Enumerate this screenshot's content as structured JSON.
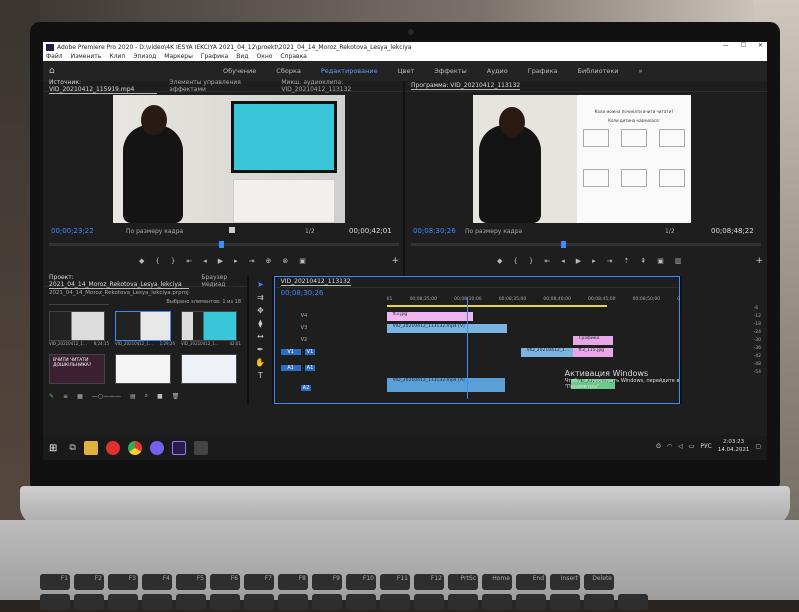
{
  "window": {
    "title": "Adobe Premiere Pro 2020 - D:\\video\\4K IESYA IEKCIYA 2021_04_12\\proekt\\2021_04_14_Moroz_Rekotova_Lesya_lekciya",
    "controls": [
      "—",
      "☐",
      "✕"
    ]
  },
  "menu": [
    "Файл",
    "Изменить",
    "Клип",
    "Эпизод",
    "Маркеры",
    "Графика",
    "Вид",
    "Окно",
    "Справка"
  ],
  "workspaces": [
    {
      "label": "Обучение",
      "active": false
    },
    {
      "label": "Сборка",
      "active": false
    },
    {
      "label": "Редактирование",
      "active": true
    },
    {
      "label": "Цвет",
      "active": false
    },
    {
      "label": "Эффекты",
      "active": false
    },
    {
      "label": "Аудио",
      "active": false
    },
    {
      "label": "Графика",
      "active": false
    },
    {
      "label": "Библиотеки",
      "active": false
    }
  ],
  "source_panel": {
    "tabs": [
      "Источник: VID_20210412_115919.mp4",
      "Элементы управления эффектами",
      "Микш. аудиоклипа: VID_20210412_113132"
    ],
    "timecode_left": "00;00;23;22",
    "fit_label": "По размеру кадра",
    "resolution": "1/2",
    "timecode_right": "00;00;42;01"
  },
  "program_panel": {
    "tab": "Программа: VID_20210412_113132",
    "timecode_left": "00;08;30;26",
    "fit_label": "По размеру кадра",
    "resolution": "1/2",
    "timecode_right": "00;08;48;22",
    "slide_title": "Коли можна починати вчити читати?",
    "slide_subtitle": "Коли дитина навчилася:"
  },
  "project_panel": {
    "tabs": [
      "Проект: 2021_04_14_Moroz_Rekotova_Lesya_lekciya",
      "Браузер медиад"
    ],
    "file": "2021_04_14_Moroz_Rekotova_Lesya_lekciya.prproj",
    "selection": "Выбрано элементов: 1 из 18",
    "items": [
      {
        "name": "VID_20210412_1...",
        "duration": "8;24;15"
      },
      {
        "name": "VID_20210412_1...",
        "duration": "1;29;26"
      },
      {
        "name": "VID_20210412_1...",
        "duration": "42;01"
      },
      {
        "name": "ВЧИТИ ЧИТАТИ ДОШКІЛЬНИКА?",
        "duration": ""
      },
      {
        "name": "",
        "duration": ""
      },
      {
        "name": "",
        "duration": ""
      }
    ]
  },
  "timeline": {
    "tab": "VID_20210412_113132",
    "timecode": "00;08;30;26",
    "ruler": [
      "01",
      "00;08;25;00",
      "00;08;30;00",
      "00;08;35;00",
      "00;08;40;00",
      "00;08;45;00",
      "00;08;50;00",
      "00;08;54;29"
    ],
    "tracks": [
      "V4",
      "V3",
      "V2",
      "V1",
      "A1",
      "A2"
    ],
    "clips": [
      {
        "label": "ft3.jpg",
        "color": "#f0b4f0"
      },
      {
        "label": "VID_20210412_113132.mp4 [V]",
        "color": "#7ab4e0"
      },
      {
        "label": "Графика",
        "color": "#e8a8e8"
      },
      {
        "label": "VID_20210412_1...",
        "color": "#7ab4e0"
      },
      {
        "label": "ft3_115.jpg",
        "color": "#e8a8e8"
      },
      {
        "label": "VID_20210412_113132.mp4 [A]",
        "color": "#5aa0d8"
      },
      {
        "label": "VID_20210412_115919.mp4 [A]",
        "color": "#66cc88"
      }
    ],
    "meter_scale": [
      "-6",
      "-12",
      "-18",
      "-24",
      "-30",
      "-36",
      "-42",
      "-48",
      "-54"
    ]
  },
  "activation": {
    "title": "Активация Windows",
    "text": "Чтобы активировать Windows, перейдите в раздел \"Параметры\"."
  },
  "taskbar": {
    "lang": "РУС",
    "time": "2:03:23",
    "date": "14.04.2021"
  },
  "keyboard": {
    "fn_keys": [
      "F1",
      "F2",
      "F3",
      "F4",
      "F5",
      "F6",
      "F7",
      "F8",
      "F9",
      "F10",
      "F11",
      "F12",
      "PrtSc",
      "Home",
      "End",
      "Insert",
      "Delete"
    ]
  },
  "colors": {
    "accent": "#3a8bff",
    "panel_bg": "#1e1e1e",
    "workspace_active": "#5aa0ff"
  }
}
